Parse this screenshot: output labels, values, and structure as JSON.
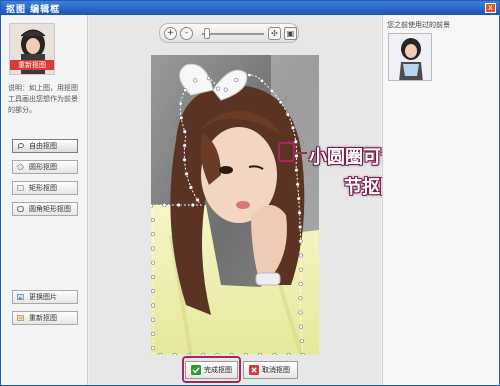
{
  "window": {
    "title": "抠图 编辑框",
    "close_label": "x"
  },
  "left_panel": {
    "avatar_label": "重新抠图",
    "hint": "说明：如上图，用抠图工具画出您想作为前景的部分。",
    "tools": [
      {
        "label": "自由抠图",
        "icon": "lasso-icon",
        "active": true
      },
      {
        "label": "圆形抠图",
        "icon": "circle-select-icon",
        "active": false
      },
      {
        "label": "矩形抠图",
        "icon": "rect-select-icon",
        "active": false
      },
      {
        "label": "圆角矩形抠图",
        "icon": "rounded-rect-select-icon",
        "active": false
      }
    ],
    "actions": [
      {
        "label": "更换图片",
        "icon": "change-image-icon"
      },
      {
        "label": "重新抠图",
        "icon": "redo-cutout-icon"
      }
    ]
  },
  "zoombar": {
    "zoom_in": "+",
    "zoom_out": "-",
    "zoom_level": 0.08
  },
  "annotation": {
    "line1": "小圆圈可调",
    "line2": "节抠图形状"
  },
  "bottom": {
    "confirm_label": "完成抠图",
    "cancel_label": "取消抠图"
  },
  "right_panel": {
    "title": "您之前使用过的前景"
  },
  "colors": {
    "titlebar": "#1b56b4",
    "accent_annotation": "#a8285c",
    "confirm_icon": "#2e9b2e",
    "cancel_icon": "#d23a3a"
  }
}
